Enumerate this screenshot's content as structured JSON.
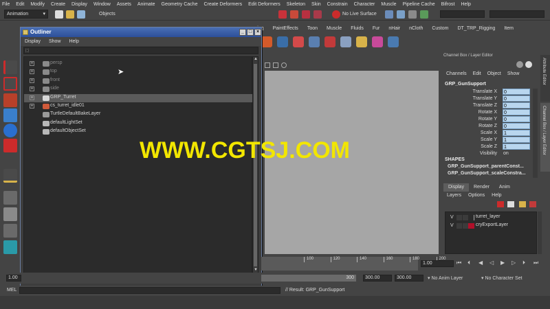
{
  "menu": [
    "File",
    "Edit",
    "Modify",
    "Create",
    "Display",
    "Window",
    "Assets",
    "Animate",
    "Geometry Cache",
    "Create Deformers",
    "Edit Deformers",
    "Skeleton",
    "Skin",
    "Constrain",
    "Character",
    "Muscle",
    "Pipeline Cache",
    "Bifrost",
    "Help"
  ],
  "status": {
    "mode": "Animation",
    "selection_mask": "Objects",
    "live_surface": "No Live Surface"
  },
  "shelf_tabs": [
    "ering",
    "PaintEffects",
    "Toon",
    "Muscle",
    "Fluids",
    "Fur",
    "nHair",
    "nCloth",
    "Custom",
    "DT_TRP_Rigging",
    "Item"
  ],
  "outliner": {
    "title": "Outliner",
    "menu": [
      "Display",
      "Show",
      "Help"
    ],
    "items": [
      {
        "label": "persp",
        "dim": true,
        "expander": "+",
        "icon": "camera-icon"
      },
      {
        "label": "top",
        "dim": true,
        "expander": "+",
        "icon": "camera-icon"
      },
      {
        "label": "front",
        "dim": true,
        "expander": "+",
        "icon": "camera-icon"
      },
      {
        "label": "side",
        "dim": true,
        "expander": "+",
        "icon": "camera-icon"
      },
      {
        "label": "GRP_Turret",
        "dim": false,
        "expander": "+",
        "icon": "group-icon",
        "selected": true
      },
      {
        "label": "cs_turret_idle01",
        "dim": false,
        "expander": "+",
        "icon": "character-set-icon"
      },
      {
        "label": "TurtleDefaultBakeLayer",
        "dim": false,
        "expander": "",
        "icon": "bake-layer-icon"
      },
      {
        "label": "defaultLightSet",
        "dim": false,
        "expander": "",
        "icon": "set-icon"
      },
      {
        "label": "defaultObjectSet",
        "dim": false,
        "expander": "",
        "icon": "set-icon"
      }
    ]
  },
  "channel_box": {
    "title": "Channel Box / Layer Editor",
    "menu": [
      "Channels",
      "Edit",
      "Object",
      "Show"
    ],
    "object": "GRP_GunSupport",
    "attributes": [
      {
        "name": "Translate X",
        "value": "0"
      },
      {
        "name": "Translate Y",
        "value": "0"
      },
      {
        "name": "Translate Z",
        "value": "0"
      },
      {
        "name": "Rotate X",
        "value": "0"
      },
      {
        "name": "Rotate Y",
        "value": "0"
      },
      {
        "name": "Rotate Z",
        "value": "0"
      },
      {
        "name": "Scale X",
        "value": "1"
      },
      {
        "name": "Scale Y",
        "value": "1"
      },
      {
        "name": "Scale Z",
        "value": "1"
      },
      {
        "name": "Visibility",
        "value": "on"
      }
    ],
    "shapes_label": "SHAPES",
    "shapes": [
      "GRP_GunSupport_parentConst...",
      "GRP_GunSupport_scaleConstra..."
    ]
  },
  "side_tabs": [
    "Attribute Editor",
    "Channel Box / Layer Editor"
  ],
  "layer_editor": {
    "tabs": [
      "Display",
      "Render",
      "Anim"
    ],
    "menu": [
      "Layers",
      "Options",
      "Help"
    ],
    "layers": [
      {
        "visible": "V",
        "name": "turret_layer",
        "color": "#2b2b2b"
      },
      {
        "visible": "V",
        "name": "cryExportLayer",
        "color": "#b0102a"
      }
    ]
  },
  "timeline": {
    "ticks": [
      "100",
      "120",
      "140",
      "160",
      "180",
      "200"
    ],
    "current_frame": "1.00"
  },
  "range": {
    "start": "1.00",
    "end_field": "300",
    "anim_end": "300.00",
    "playback_end": "300.00",
    "anim_layer": "No Anim Layer",
    "character_set": "No Character Set"
  },
  "command": {
    "label": "MEL",
    "result": "// Result: GRP_GunSupport"
  },
  "watermark": "WWW.CGTSJ.COM"
}
